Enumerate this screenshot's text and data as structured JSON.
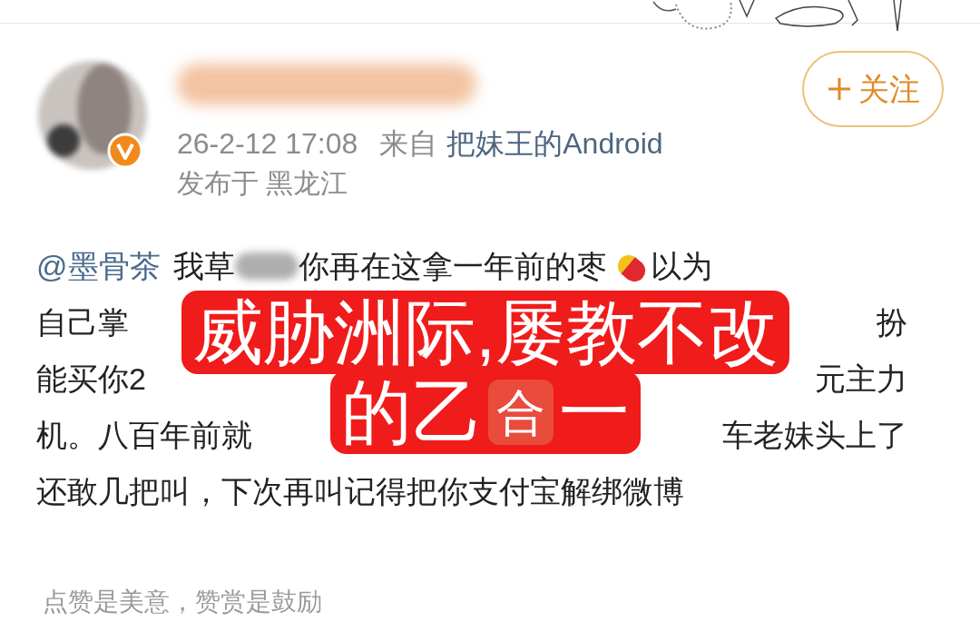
{
  "post": {
    "author": {
      "verified": true
    },
    "follow_button": "关注",
    "meta": {
      "time": "26-2-12 17:08",
      "source_label": "来自",
      "source": "把妹王的Android",
      "location": "发布于 黑龙江"
    },
    "body_lines": [
      {
        "segments": [
          {
            "kind": "mention",
            "text": "@墨骨茶"
          },
          {
            "kind": "text",
            "text": "我草"
          },
          {
            "kind": "redaction"
          },
          {
            "kind": "text",
            "text": "你再在这拿一年前的枣"
          },
          {
            "kind": "pill"
          },
          {
            "kind": "text",
            "text": "以为"
          }
        ]
      },
      {
        "segments": [
          {
            "kind": "text",
            "text": "自己掌"
          },
          {
            "kind": "gap"
          },
          {
            "kind": "text",
            "text": "扮"
          }
        ]
      },
      {
        "segments": [
          {
            "kind": "text",
            "text": "能买你2"
          },
          {
            "kind": "gap"
          },
          {
            "kind": "text",
            "text": "元主力"
          }
        ]
      },
      {
        "segments": [
          {
            "kind": "text",
            "text": "机。八百年前就"
          },
          {
            "kind": "gap"
          },
          {
            "kind": "text",
            "text": "车老妹头上了"
          }
        ]
      },
      {
        "segments": [
          {
            "kind": "text",
            "text": "还敢几把叫，下次再叫记得把你支付宝解绑微博"
          }
        ]
      }
    ],
    "footer": "点赞是美意，赞赏是鼓励"
  },
  "caption_overlay": {
    "lines": [
      {
        "segments": [
          {
            "kind": "text",
            "text": "威胁洲际,屡教不改"
          }
        ]
      },
      {
        "segments": [
          {
            "kind": "text",
            "text": "的乙"
          },
          {
            "kind": "emoji_box",
            "text": "合"
          },
          {
            "kind": "text",
            "text": "一"
          }
        ]
      }
    ]
  }
}
